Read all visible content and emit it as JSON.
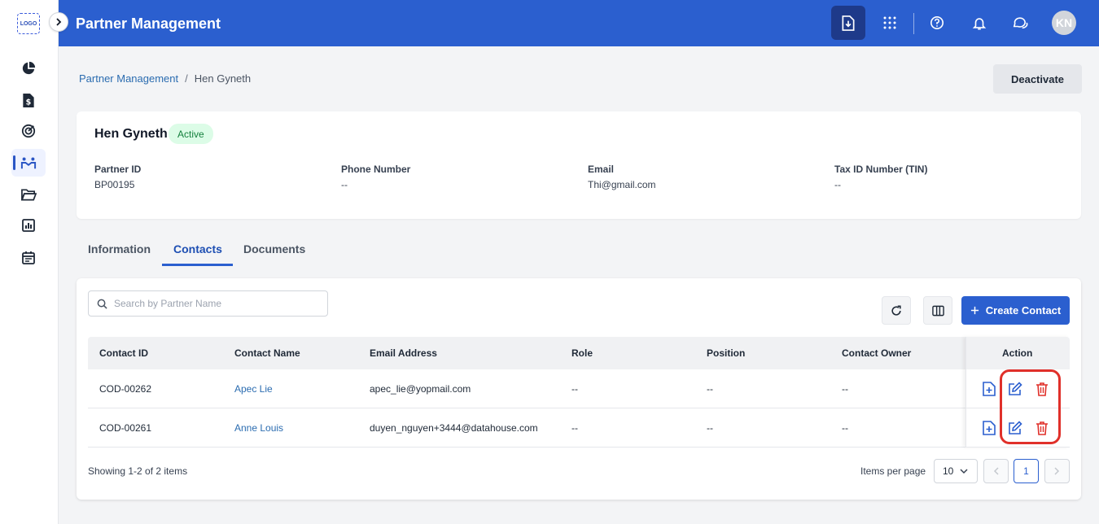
{
  "sidebar": {
    "logo": "LOGO",
    "items": [
      {
        "name": "sidebar-item-dashboard",
        "icon": "pie-chart-icon"
      },
      {
        "name": "sidebar-item-invoices",
        "icon": "dollar-file-icon"
      },
      {
        "name": "sidebar-item-targets",
        "icon": "target-icon"
      },
      {
        "name": "sidebar-item-partners",
        "icon": "partners-icon",
        "active": true
      },
      {
        "name": "sidebar-item-documents",
        "icon": "folder-icon"
      },
      {
        "name": "sidebar-item-reports",
        "icon": "report-chart-icon"
      },
      {
        "name": "sidebar-item-calendar",
        "icon": "calendar-icon"
      }
    ]
  },
  "header": {
    "title": "Partner Management",
    "avatar_initials": "KN",
    "icons": [
      "download-file-icon",
      "apps-grid-icon",
      "help-icon",
      "bell-icon",
      "chat-icon"
    ]
  },
  "breadcrumb": {
    "parent": "Partner Management",
    "separator": "/",
    "current": "Hen Gyneth"
  },
  "actions": {
    "deactivate_label": "Deactivate"
  },
  "partner": {
    "name": "Hen Gyneth",
    "status": "Active",
    "fields": [
      {
        "label": "Partner ID",
        "value": "BP00195"
      },
      {
        "label": "Phone Number",
        "value": "--"
      },
      {
        "label": "Email",
        "value": "Thi@gmail.com"
      },
      {
        "label": "Tax ID Number (TIN)",
        "value": "--"
      }
    ]
  },
  "tabs": [
    {
      "label": "Information",
      "active": false
    },
    {
      "label": "Contacts",
      "active": true
    },
    {
      "label": "Documents",
      "active": false
    }
  ],
  "contacts": {
    "search_placeholder": "Search by Partner Name",
    "create_label": "Create Contact",
    "columns": [
      "Contact ID",
      "Contact Name",
      "Email Address",
      "Role",
      "Position",
      "Contact Owner",
      "Action"
    ],
    "rows": [
      {
        "id": "COD-00262",
        "name": "Apec Lie",
        "email": "apec_lie@yopmail.com",
        "role": "--",
        "position": "--",
        "owner": "--"
      },
      {
        "id": "COD-00261",
        "name": "Anne Louis",
        "email": "duyen_nguyen+3444@datahouse.com",
        "role": "--",
        "position": "--",
        "owner": "--"
      }
    ],
    "showing_text": "Showing 1-2 of 2 items",
    "items_per_page_label": "Items per page",
    "items_per_page_value": "10",
    "current_page": "1"
  },
  "colors": {
    "header_bg": "#2b5fcf",
    "accent": "#2b5fcf",
    "link": "#2b6cb0",
    "status_bg": "#dcfce7",
    "status_text": "#15803d",
    "delete": "#e0302a",
    "highlight": "#e0302a"
  }
}
